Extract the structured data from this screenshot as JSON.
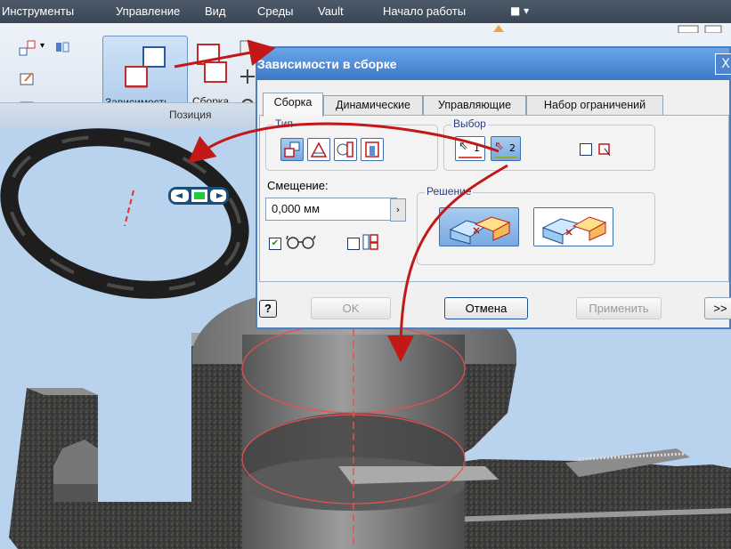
{
  "menu": {
    "items": [
      "Инструменты",
      "Управление",
      "Вид",
      "Среды",
      "Vault",
      "Начало работы"
    ],
    "extra_icon": "camera-dropdown-icon"
  },
  "ribbon": {
    "constraint_label": "Зависимость",
    "assembly_label": "Сборка",
    "panel_title": "Позиция"
  },
  "dialog": {
    "title": "Зависимости в сборке",
    "close_glyph": "X",
    "tabs": [
      "Сборка",
      "Динамические",
      "Управляющие",
      "Набор ограничений"
    ],
    "active_tab": "Сборка",
    "type_group_label": "Тип",
    "selection_group_label": "Выбор",
    "select1_label": "1",
    "select2_label": "2",
    "offset_label": "Смещение:",
    "offset_value": "0,000 мм",
    "solution_group_label": "Решение",
    "buttons": {
      "help": "?",
      "ok": "OK",
      "cancel": "Отмена",
      "apply": "Применить",
      "more": ">>"
    }
  },
  "colors": {
    "dialog_title": "#3c78c8",
    "annotation_arrow": "#c21818",
    "viewport_bg": "#b9d3ee",
    "part_edge": "#e85050"
  }
}
